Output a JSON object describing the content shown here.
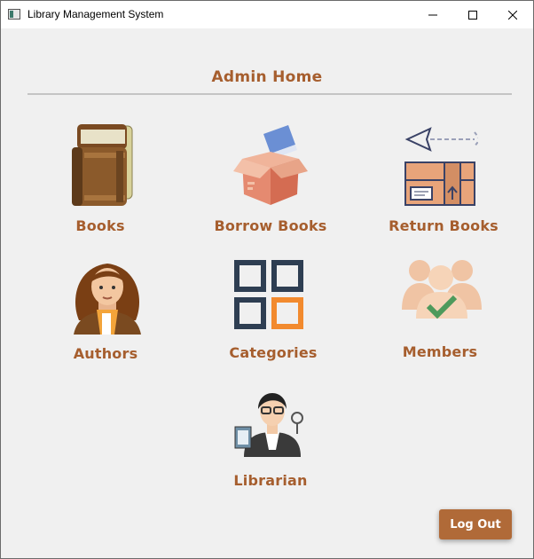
{
  "window": {
    "title": "Library Management System"
  },
  "page": {
    "heading": "Admin Home"
  },
  "tiles": {
    "books": "Books",
    "borrow": "Borrow Books",
    "return": "Return Books",
    "authors": "Authors",
    "categories": "Categories",
    "members": "Members",
    "librarian": "Librarian"
  },
  "actions": {
    "logout": "Log Out"
  },
  "colors": {
    "accent_text": "#a65e2e",
    "logout_button": "#b06a38"
  }
}
